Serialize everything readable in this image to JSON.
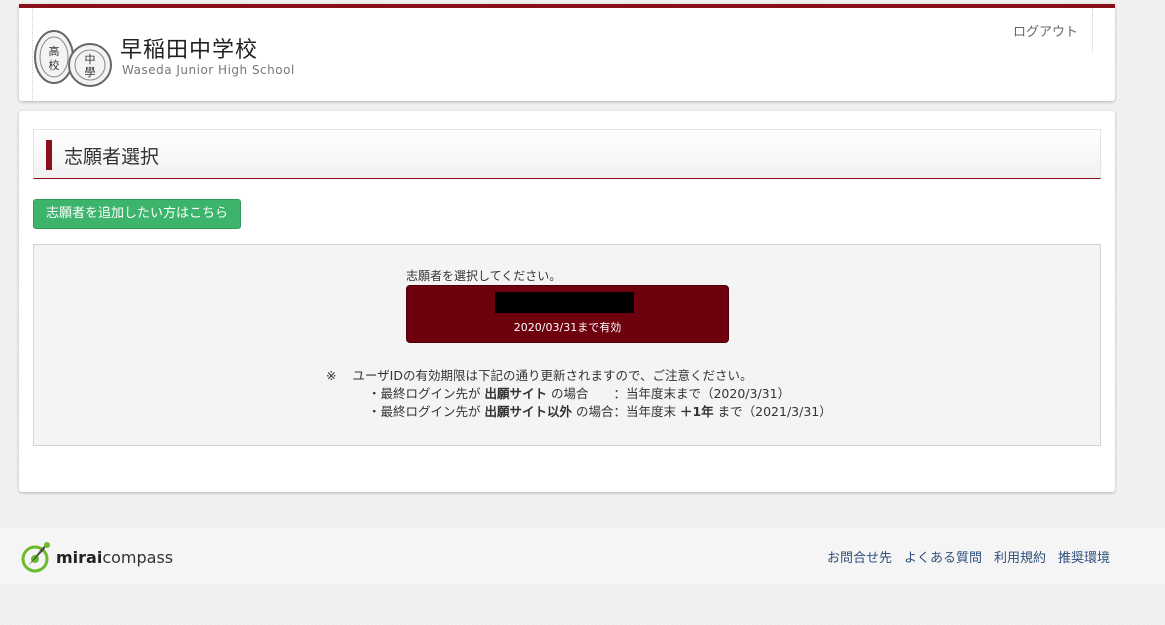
{
  "header": {
    "school_name": "早稲田中学校",
    "school_name_en": "Waseda Junior High School",
    "logout_label": "ログアウト",
    "crest_left_text": "高校",
    "crest_right_text": "中學"
  },
  "main": {
    "section_title": "志願者選択",
    "add_applicant_label": "志願者を追加したい方はこちら",
    "prompt": "志願者を選択してください。",
    "applicant": {
      "valid_until": "2020/03/31まで有効"
    },
    "note": {
      "mark": "※",
      "line1": "ユーザIDの有効期限は下記の通り更新されますので、ご注意ください。",
      "line2_pre": "・最終ログイン先が ",
      "line2_bold": "出願サイト",
      "line2_post": " の場合　　：当年度末まで（2020/3/31）",
      "line3_pre": "・最終ログイン先が ",
      "line3_bold": "出願サイト以外",
      "line3_mid": " の場合：当年度末 ",
      "line3_bold2": "＋1年",
      "line3_post": " まで（2021/3/31）"
    }
  },
  "footer": {
    "brand_bold": "mirai",
    "brand_rest": "compass",
    "links": [
      "お問合せ先",
      "よくある質問",
      "利用規約",
      "推奨環境"
    ]
  },
  "colors": {
    "accent": "#8a0f1b",
    "applicant_button": "#6f000d",
    "add_button": "#3db46b",
    "link": "#2d4f7c",
    "brand_green": "#6cbb2c"
  }
}
